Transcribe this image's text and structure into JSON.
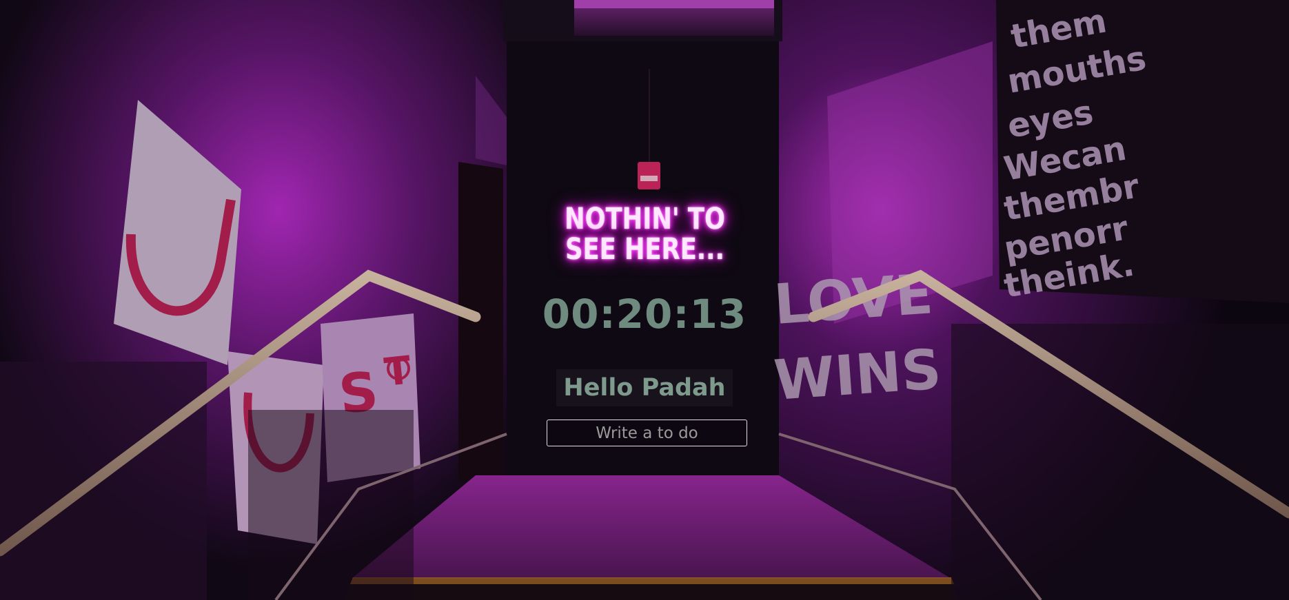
{
  "background": {
    "accent_color": "#c227d6",
    "dark_color": "#0a0610"
  },
  "neon_sign": {
    "line1": "NOTHIN' TO",
    "line2": "SEE HERE..."
  },
  "clock": {
    "time": "00:20:13"
  },
  "greeting": {
    "text": "Hello Padah"
  },
  "todo": {
    "placeholder": "Write a to do"
  }
}
